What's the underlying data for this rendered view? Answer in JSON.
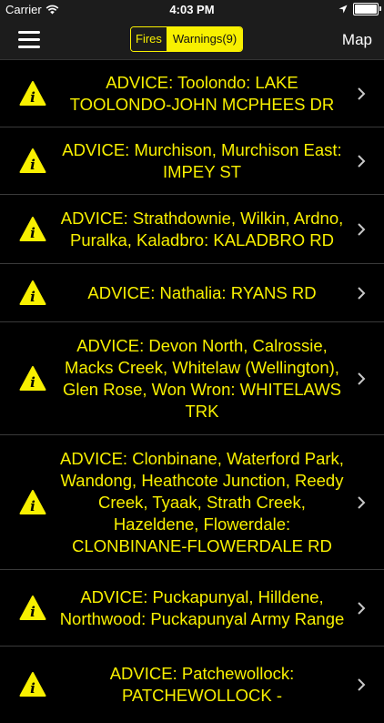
{
  "status_bar": {
    "carrier": "Carrier",
    "time": "4:03 PM",
    "battery_level": 1.0
  },
  "nav": {
    "fires_label": "Fires",
    "warnings_label": "Warnings(9)",
    "map_label": "Map",
    "selected_segment": "warnings"
  },
  "colors": {
    "accent": "#f8f000",
    "background": "#000000",
    "bar": "#1c1c1c"
  },
  "warnings": [
    {
      "icon": "info-warning-icon",
      "text": "ADVICE: Toolondo: LAKE TOOLONDO-JOHN MCPHEES DR"
    },
    {
      "icon": "info-warning-icon",
      "text": "ADVICE: Murchison, Murchison East: IMPEY ST"
    },
    {
      "icon": "info-warning-icon",
      "text": "ADVICE: Strathdownie, Wilkin, Ardno, Puralka, Kaladbro: KALADBRO RD"
    },
    {
      "icon": "info-warning-icon",
      "text": "ADVICE: Nathalia: RYANS RD"
    },
    {
      "icon": "info-warning-icon",
      "text": "ADVICE: Devon North, Calrossie, Macks Creek, Whitelaw (Wellington), Glen Rose, Won Wron: WHITELAWS TRK"
    },
    {
      "icon": "info-warning-icon",
      "text": "ADVICE: Clonbinane, Waterford Park, Wandong, Heathcote Junction, Reedy Creek, Tyaak, Strath Creek, Hazeldene, Flowerdale: CLONBINANE-FLOWERDALE RD"
    },
    {
      "icon": "info-warning-icon",
      "text": "ADVICE: Puckapunyal, Hilldene, Northwood: Puckapunyal Army Range"
    },
    {
      "icon": "info-warning-icon",
      "text": "ADVICE: Patchewollock: PATCHEWOLLOCK -"
    }
  ]
}
